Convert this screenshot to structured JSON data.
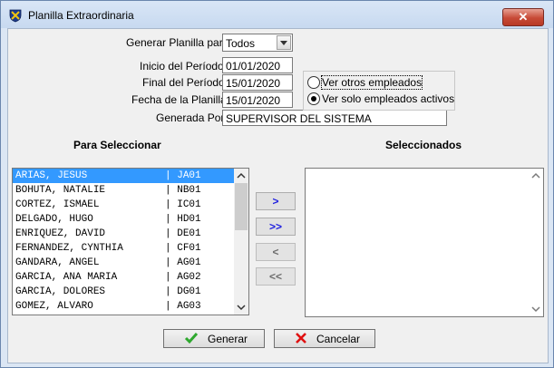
{
  "window": {
    "title": "Planilla Extraordinaria",
    "close_label": "✕"
  },
  "form": {
    "generar_label": "Generar Planilla para:",
    "generar_value": "Todos",
    "inicio_label": "Inicio del Período:",
    "inicio_value": "01/01/2020",
    "final_label": "Final del Período:",
    "final_value": "15/01/2020",
    "fecha_label": "Fecha de la Planilla:",
    "fecha_value": "15/01/2020",
    "generada_label": "Generada Por:",
    "generada_value": "SUPERVISOR DEL SISTEMA"
  },
  "radios": {
    "otros": "Ver otros empleados",
    "activos": "Ver solo empleados activos",
    "selected": "activos"
  },
  "lists": {
    "left_header": "Para Seleccionar",
    "right_header": "Seleccionados",
    "items": [
      "ARIAS, JESUS             | JA01",
      "BOHUTA, NATALIE          | NB01",
      "CORTEZ, ISMAEL           | IC01",
      "DELGADO, HUGO            | HD01",
      "ENRIQUEZ, DAVID          | DE01",
      "FERNANDEZ, CYNTHIA       | CF01",
      "GANDARA, ANGEL           | AG01",
      "GARCIA, ANA MARIA        | AG02",
      "GARCIA, DOLORES          | DG01",
      "GOMEZ, ALVARO            | AG03"
    ],
    "selected_index": 0
  },
  "move_buttons": {
    "add_one": ">",
    "add_all": ">>",
    "remove_one": "<",
    "remove_all": "<<"
  },
  "actions": {
    "generar": "Generar",
    "cancelar": "Cancelar"
  },
  "colors": {
    "selection": "#3399ff",
    "move_active": "#2020e0",
    "check": "#2ea82e",
    "cancel_x": "#e01010"
  }
}
